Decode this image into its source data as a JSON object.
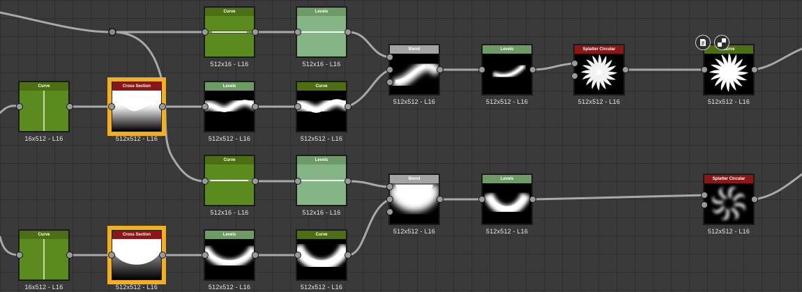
{
  "nodes": {
    "curve_top_1": {
      "title": "Curve",
      "res": "512x16 - L16"
    },
    "levels_top_1": {
      "title": "Levels",
      "res": "512x16 - L16"
    },
    "curve_left_1": {
      "title": "Curve",
      "res": "16x512 - L16"
    },
    "cross_section_1": {
      "title": "Cross Section",
      "res": "512x512 - L16"
    },
    "levels_mid_1": {
      "title": "Levels",
      "res": "512x512 - L16"
    },
    "curve_mid_1": {
      "title": "Curve",
      "res": "512x512 - L16"
    },
    "blend_1": {
      "title": "Blend",
      "res": "512x512 - L16"
    },
    "levels_out_1": {
      "title": "Levels",
      "res": "512x512 - L16"
    },
    "splatter_1": {
      "title": "Splatter Circular",
      "res": "512x512 - L16"
    },
    "curve_out_1": {
      "title": "Curve",
      "res": "512x512 - L16"
    },
    "curve_top_2": {
      "title": "Curve",
      "res": "512x16 - L16"
    },
    "levels_top_2": {
      "title": "Levels",
      "res": "512x16 - L16"
    },
    "blend_2": {
      "title": "Blend",
      "res": "512x512 - L16"
    },
    "levels_out_2": {
      "title": "Levels",
      "res": "512x512 - L16"
    },
    "splatter_2": {
      "title": "Splatter Circular",
      "res": "512x512 - L16"
    },
    "curve_left_2": {
      "title": "Curve",
      "res": "16x512 - L16"
    },
    "cross_section_2": {
      "title": "Cross Section",
      "res": "512x512 - L16"
    },
    "levels_mid_2": {
      "title": "Levels",
      "res": "512x512 - L16"
    },
    "curve_mid_2": {
      "title": "Curve",
      "res": "512x512 - L16"
    }
  },
  "colors": {
    "background": "#3a3a3a",
    "grid": "#2f2f2f",
    "wire": "#a9a9a9",
    "selection": "#f2b01e",
    "header_curve": "#4d6f14",
    "header_levels": "#6e9a66",
    "header_cross_section": "#8a1616",
    "header_blend": "#a4a4a4"
  },
  "icons": {
    "node_toolbar": [
      "document-icon",
      "checker-icon"
    ]
  }
}
